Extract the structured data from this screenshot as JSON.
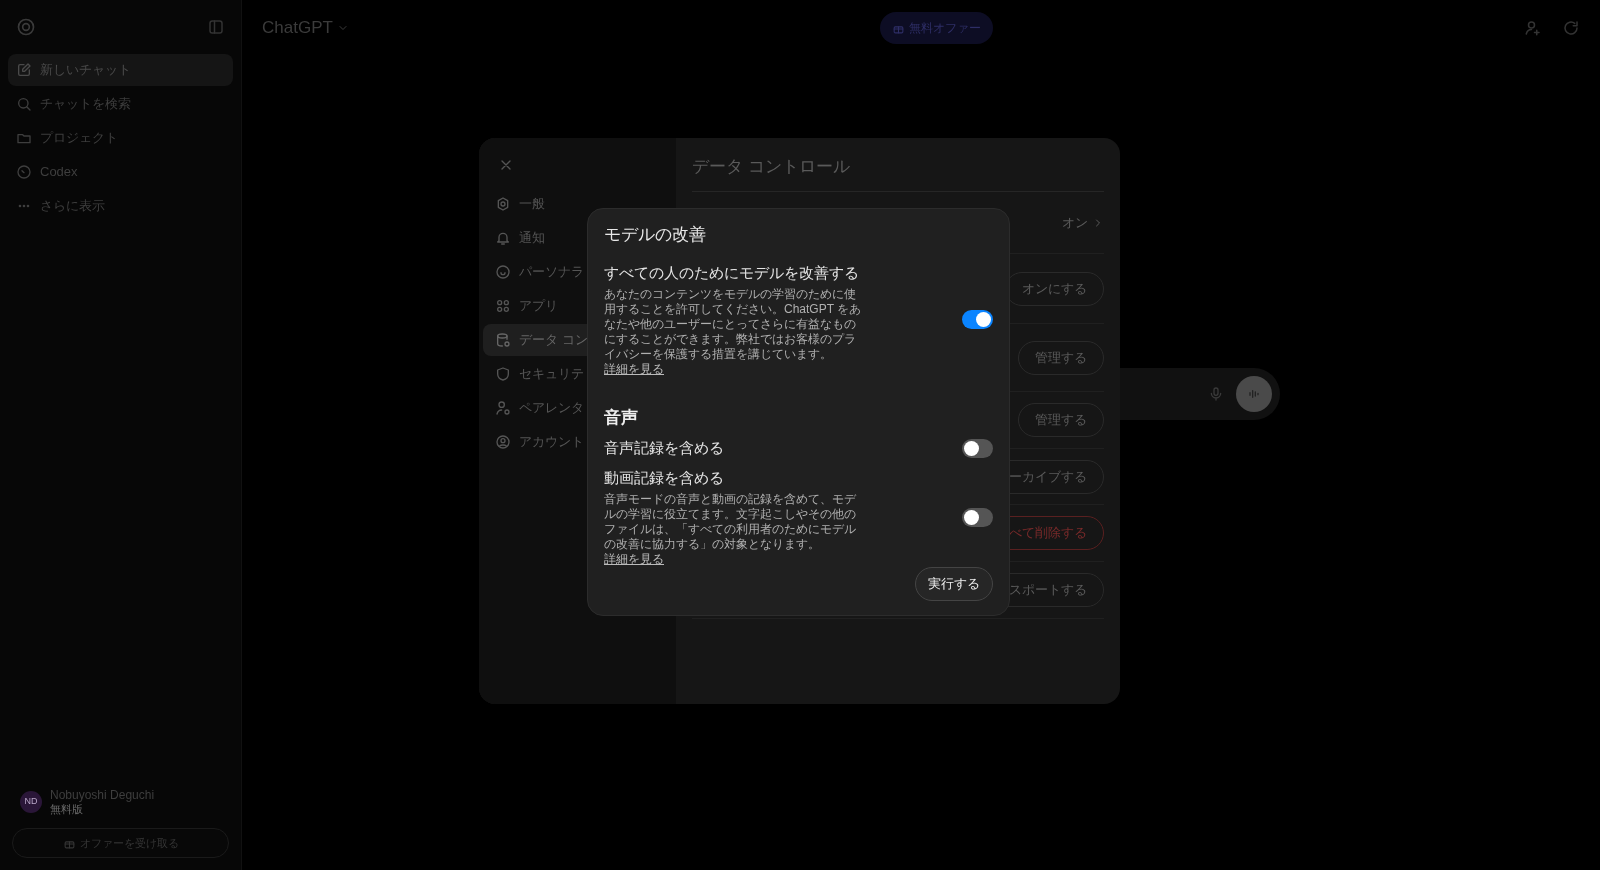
{
  "sidebar": {
    "items": [
      {
        "label": "新しいチャット",
        "selected": true
      },
      {
        "label": "チャットを検索",
        "selected": false
      },
      {
        "label": "プロジェクト",
        "selected": false
      },
      {
        "label": "Codex",
        "selected": false
      },
      {
        "label": "さらに表示",
        "selected": false
      }
    ],
    "user": {
      "initials": "ND",
      "name": "Nobuyoshi Deguchi",
      "plan": "無料版"
    },
    "offer_button": "オファーを受け取る"
  },
  "header": {
    "model": "ChatGPT",
    "offer": "無料オファー"
  },
  "settings": {
    "title": "データ コントロール",
    "nav": [
      {
        "label": "一般",
        "selected": false
      },
      {
        "label": "通知",
        "selected": false
      },
      {
        "label": "パーソナラ",
        "selected": false
      },
      {
        "label": "アプリ",
        "selected": false
      },
      {
        "label": "データ コン",
        "selected": true
      },
      {
        "label": "セキュリテ",
        "selected": false
      },
      {
        "label": "ペアレンタ",
        "selected": false
      },
      {
        "label": "アカウント",
        "selected": false
      }
    ],
    "rows": [
      {
        "kind": "link",
        "value": "オン"
      },
      {
        "kind": "button",
        "value": "オンにする",
        "danger": false
      },
      {
        "kind": "button",
        "value": "管理する",
        "danger": false
      },
      {
        "kind": "button",
        "value": "管理する",
        "danger": false
      },
      {
        "kind": "button",
        "value": "ーカイブする",
        "danger": false
      },
      {
        "kind": "button",
        "value": "べて削除する",
        "danger": true
      },
      {
        "kind": "button",
        "value": "スポートする",
        "danger": false
      }
    ]
  },
  "dialog": {
    "title": "モデルの改善",
    "sections": [
      {
        "settings": [
          {
            "label": "すべての人のためにモデルを改善する",
            "description": "あなたのコンテンツをモデルの学習のために使用することを許可してください。ChatGPT をあなたや他のユーザーにとってさらに有益なものにすることができます。弊社ではお客様のプライバシーを保護する措置を講じています。",
            "link": "詳細を見る",
            "on": true
          }
        ]
      },
      {
        "heading": "音声",
        "settings": [
          {
            "label": "音声記録を含める",
            "on": false
          },
          {
            "label": "動画記録を含める",
            "description": "音声モードの音声と動画の記録を含めて、モデルの学習に役立てます。文字起こしやその他のファイルは、「すべての利用者のためにモデルの改善に協力する」の対象となります。",
            "link": "詳細を見る",
            "on": false
          }
        ]
      }
    ],
    "button": "実行する"
  }
}
